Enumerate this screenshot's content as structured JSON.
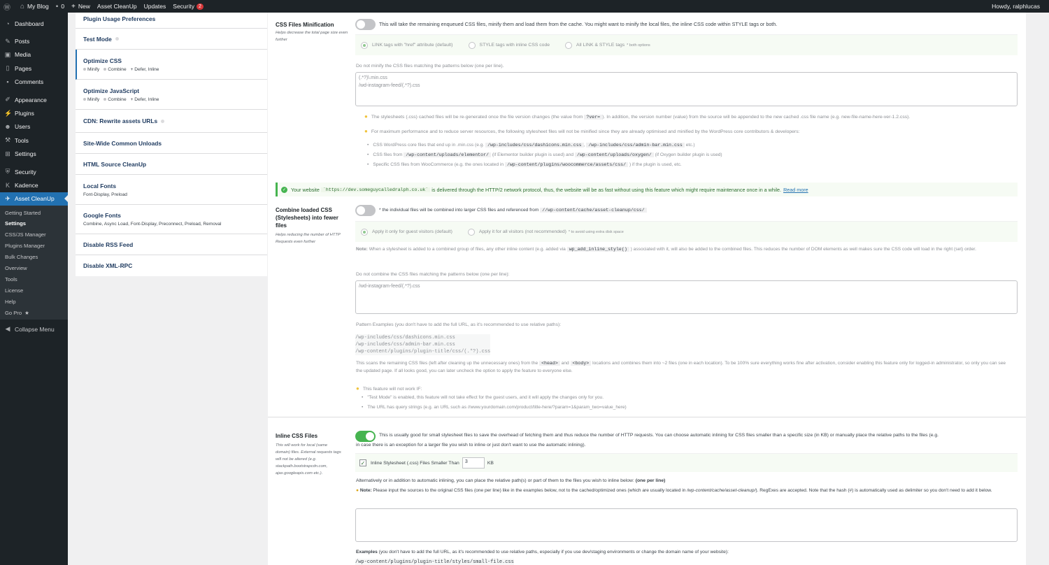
{
  "adminbar": {
    "site_name": "My Blog",
    "comments_count": "0",
    "new_label": "New",
    "asset_cleanup": "Asset CleanUp",
    "updates": "Updates",
    "security": "Security",
    "security_badge": "2",
    "howdy": "Howdy, ralphlucas"
  },
  "menu": {
    "dashboard": "Dashboard",
    "posts": "Posts",
    "media": "Media",
    "pages": "Pages",
    "comments": "Comments",
    "appearance": "Appearance",
    "plugins": "Plugins",
    "users": "Users",
    "tools": "Tools",
    "settings": "Settings",
    "security": "Security",
    "kadence": "Kadence",
    "asset_cleanup": "Asset CleanUp",
    "sub": [
      "Getting Started",
      "Settings",
      "CSS/JS Manager",
      "Plugins Manager",
      "Bulk Changes",
      "Overview",
      "Tools",
      "License",
      "Help",
      "Go Pro"
    ],
    "collapse": "Collapse Menu"
  },
  "settings_nav": [
    {
      "title": "Plugin Usage Preferences"
    },
    {
      "title": "Test Mode"
    },
    {
      "title": "Optimize CSS",
      "subs": [
        "Minify",
        "Combine",
        "+ Defer, Inline"
      ]
    },
    {
      "title": "Optimize JavaScript",
      "subs": [
        "Minify",
        "Combine",
        "+ Defer, Inline"
      ]
    },
    {
      "title": "CDN: Rewrite assets URLs"
    },
    {
      "title": "Site-Wide Common Unloads"
    },
    {
      "title": "HTML Source CleanUp"
    },
    {
      "title": "Local Fonts",
      "sub_text": "Font-Display, Preload"
    },
    {
      "title": "Google Fonts",
      "sub_text": "Combine, Async Load, Font-Display, Preconnect, Preload, Removal"
    },
    {
      "title": "Disable RSS Feed"
    },
    {
      "title": "Disable XML-RPC"
    }
  ],
  "minify": {
    "title": "CSS Files Minification",
    "desc": "Helps decrease the total page size even further",
    "toggle_on": false,
    "toggle_text": "This will take the remaining enqueued CSS files, minify them and load them from the cache. You might want to minify the local files, the inline CSS code within STYLE tags or both.",
    "radio1": "LINK tags with \"href\" attribute (default)",
    "radio2": "STYLE tags with inline CSS code",
    "radio3": "All LINK & STYLE tags",
    "radio3_note": "* both options",
    "exclude_label": "Do not minify the CSS files matching the patterns below (one per line).",
    "exclude_value": "(.*?)\\.min.css\n/wd-instagram-feed/(.*?).css",
    "tip1_a": "The stylesheets (.css) cached files will be re-generated once the file version changes (the value from",
    "tip1_code": "?ver=",
    "tip1_b": "). In addition, the version number (value) from the source will be appended to the new cached .css file name (e.g. new-file-name-here-ver-1.2.css).",
    "tip2": "For maximum performance and to reduce server resources, the following stylesheet files will not be minified since they are already optimised and minified by the WordPress core contributors & developers:",
    "li1_a": "CSS WordPress core files that end up in .min.css (e.g.",
    "li1_code1": "/wp-includes/css/dashicons.min.css",
    "li1_code2": "/wp-includes/css/admin-bar.min.css",
    "li1_b": "etc.)",
    "li2_a": "CSS files from",
    "li2_code1": "/wp-content/uploads/elementor/",
    "li2_b": "(if Elementor builder plugin is used) and",
    "li2_code2": "/wp-content/uploads/oxygen/",
    "li2_c": "(if Oxygen builder plugin is used)",
    "li3_a": "Specific CSS files from WooCommerce (e.g. the ones located in",
    "li3_code": "/wp-content/plugins/woocommerce/assets/css/",
    "li3_b": ") if the plugin is used, etc."
  },
  "notice": {
    "text_a": "Your website",
    "domain": "`https://dev.someguycalledralph.co.uk`",
    "text_b": "is delivered through the HTTP/2 network protocol, thus, the website will be as fast without using this feature which might require maintenance once in a while.",
    "link": "Read more"
  },
  "combine": {
    "title": "Combine loaded CSS (Stylesheets) into fewer files",
    "desc": "Helps reducing the number of HTTP Requests even further",
    "toggle_on": false,
    "toggle_text": "* the individual files will be combined into larger CSS files and referenced from",
    "toggle_code": "//wp-content/cache/asset-cleanup/css/",
    "radio1": "Apply it only for guest visitors (default)",
    "radio2": "Apply it for all visitors (not recommended)",
    "radio2_note": "* to avoid using extra disk space",
    "note_label": "Note:",
    "note_a": "When a stylesheet is added to a combined group of files, any other inline content (e.g. added via",
    "note_code": "wp_add_inline_style()",
    "note_b": ") associated with it, will also be added to the combined files. This reduces the number of DOM elements as well makes sure the CSS code will load in the right (set) order.",
    "exclude_label": "Do not combine the CSS files matching the patterns below (one per line):",
    "exclude_value": "/wd-instagram-feed/(.*?).css",
    "pattern_label": "Pattern Examples (you don't have to add the full URL, as it's recommended to use relative paths):",
    "patterns": "/wp-includes/css/dashicons.min.css\n/wp-includes/css/admin-bar.min.css\n/wp-content/plugins/plugin-title/css/(.*?).css",
    "scan_a": "This scans the remaining CSS files (left after cleaning up the unnecessary ones) from the",
    "scan_code1": "<head>",
    "scan_and": "and",
    "scan_code2": "<body>",
    "scan_b": "locations and combines them into ~2 files (one in each location). To be 100% sure everything works fine after activation, consider enabling this feature only for",
    "scan_c": "logged-in administrator, so only you can see the updated page. If all looks good, you can later uncheck the option to apply the feature to everyone else.",
    "wont_work": "This feature will not work IF:",
    "li1": "\"Test Mode\" is enabled, this feature will not take effect for the guest users, and it will apply the changes only for you.",
    "li2": "The URL has query strings (e.g. an URL such as //www.yourdomain.com/product/title-here/?param=1&param_two=value_here)"
  },
  "inline": {
    "title": "Inline CSS Files",
    "desc": "This will work for local (same domain) files. External requests tags will not be altered (e.g. stackpath.bootstrapcdn.com, ajax.googleapis.com etc.).",
    "toggle_on": true,
    "toggle_text_a": "This is usually good for small stylesheet files to save the overhead of fetching them and thus reduce the number of HTTP requests. You can choose automatic inlining for CSS files smaller than a specific size (in KB) or manually place the relative paths to the files (e.g.",
    "toggle_text_b": "in case there is an exception for a larger file you wish to inline or just don't want to use the automatic inlining).",
    "checkbox_label": "Inline Stylesheet (.css) Files Smaller Than",
    "size_value": "3",
    "size_unit": "KB",
    "alt_a": "Alternatively or in addition to automatic inlining, you can place the relative path(s) or part of them to the files you wish to inline below:",
    "alt_b": "(one per line)",
    "note_label": "Note:",
    "note_a": "Please input the sources to the original CSS files (one per line) like in the examples below, not to the cached/optimized ones (which are usually located in",
    "note_path": "/wp-content/cache/asset-cleanup/",
    "note_b": "). RegExes are accepted. Note that the hash (#) is automatically used as",
    "note_c": "delimiter so you don't need to add it below.",
    "examples_label": "Examples",
    "examples_text": "(you don't have to add the full URL, as it's recommended to use relative paths, especially if you use dev/staging environments or change the domain name of your website):",
    "example1": "/wp-content/plugins/plugin-title/styles/small-file.css"
  }
}
